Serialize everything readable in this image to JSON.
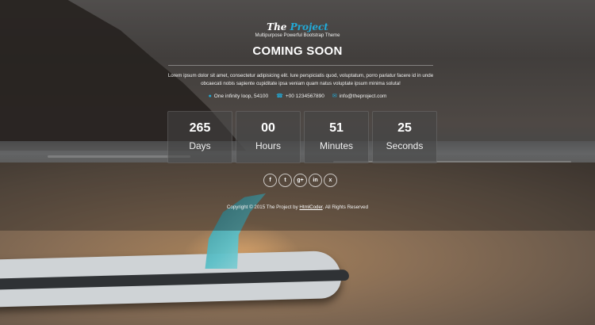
{
  "brand": {
    "name_a": "The",
    "name_b": "Project",
    "tagline": "Multipurpose Powerful Bootstrap Theme"
  },
  "headline": "COMING SOON",
  "description": "Lorem ipsum dolor sit amet, consectetur adipisicing elit. Iure perspiciatis quod, voluptatum, porro pariatur facere id in unde obcaecati nobis sapiente cupiditate ipsa veniam quam natus voluptate ipsum minima soluta!",
  "contacts": [
    {
      "icon": "map-marker-icon",
      "text": "One infinity loop, 54100"
    },
    {
      "icon": "phone-icon",
      "text": "+00 1234567890"
    },
    {
      "icon": "envelope-icon",
      "text": "info@theproject.com"
    }
  ],
  "countdown": [
    {
      "value": "265",
      "label": "Days"
    },
    {
      "value": "00",
      "label": "Hours"
    },
    {
      "value": "51",
      "label": "Minutes"
    },
    {
      "value": "25",
      "label": "Seconds"
    }
  ],
  "socials": [
    {
      "icon": "facebook-icon",
      "glyph": "f"
    },
    {
      "icon": "twitter-icon",
      "glyph": "t"
    },
    {
      "icon": "google-plus-icon",
      "glyph": "g+"
    },
    {
      "icon": "linkedin-icon",
      "glyph": "in"
    },
    {
      "icon": "xing-icon",
      "glyph": "x"
    }
  ],
  "footer": {
    "prefix": "Copyright © 2015 The Project by ",
    "link": "HtmlCoder",
    "suffix": ". All Rights Reserved"
  },
  "colors": {
    "accent": "#22a9d6"
  }
}
